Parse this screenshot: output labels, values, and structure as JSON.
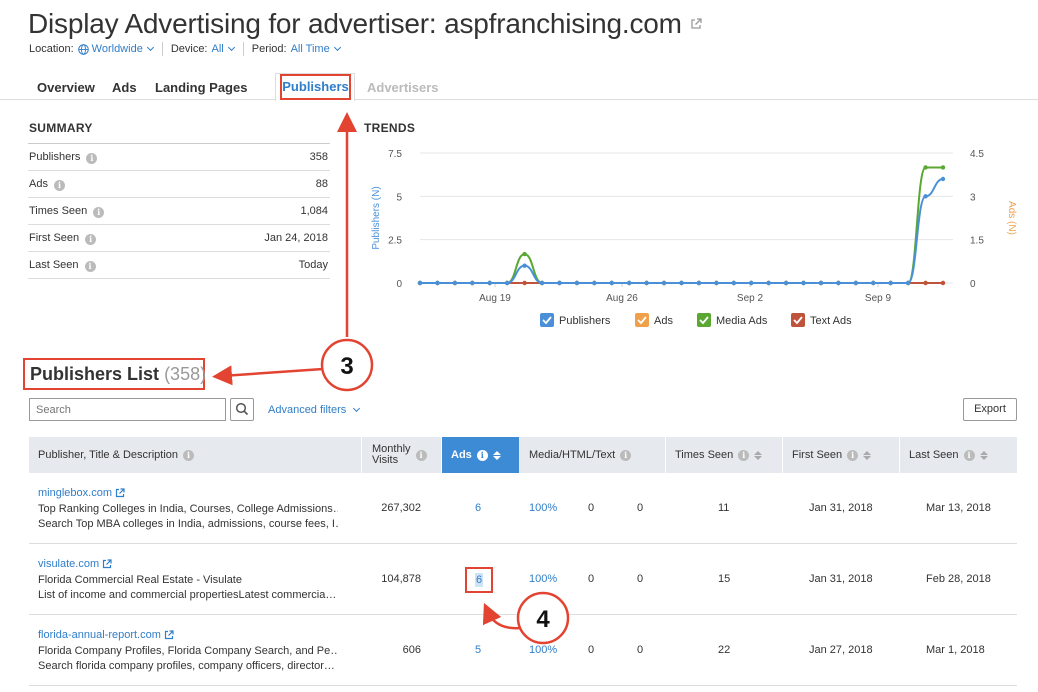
{
  "header": {
    "title_prefix": "Display Advertising for advertiser:",
    "title_domain": "aspfranchising.com",
    "location_label": "Location:",
    "location_value": "Worldwide",
    "device_label": "Device:",
    "device_value": "All",
    "period_label": "Period:",
    "period_value": "All Time"
  },
  "tabs": {
    "overview": "Overview",
    "ads": "Ads",
    "landing_pages": "Landing Pages",
    "publishers": "Publishers",
    "advertisers": "Advertisers"
  },
  "summary": {
    "heading": "SUMMARY",
    "rows": [
      {
        "label": "Publishers",
        "value": "358"
      },
      {
        "label": "Ads",
        "value": "88"
      },
      {
        "label": "Times Seen",
        "value": "1,084"
      },
      {
        "label": "First Seen",
        "value": "Jan 24, 2018"
      },
      {
        "label": "Last Seen",
        "value": "Today"
      }
    ]
  },
  "trends": {
    "heading": "TRENDS"
  },
  "chart_data": {
    "type": "line",
    "title": "TRENDS",
    "xlabel": "",
    "ylabel": "Publishers (N)",
    "y2label": "Ads (N)",
    "ylim": [
      0,
      7.5
    ],
    "y2lim": [
      0,
      4.5
    ],
    "yticks": [
      "0",
      "2.5",
      "5",
      "7.5"
    ],
    "y2ticks": [
      "0",
      "1.5",
      "3",
      "4.5"
    ],
    "xticks": [
      "Aug 19",
      "Aug 26",
      "Sep 2",
      "Sep 9"
    ],
    "x": [
      "Aug 14",
      "Aug 16",
      "Aug 18",
      "Aug 20",
      "Aug 22",
      "Aug 24",
      "Aug 26",
      "Aug 28",
      "Aug 30",
      "Sep 1",
      "Sep 3",
      "Sep 5",
      "Sep 7",
      "Sep 9",
      "Sep 11",
      "Sep 13"
    ],
    "series": [
      {
        "name": "Publishers",
        "color": "#4a90d9",
        "axis": "left",
        "values": [
          0,
          0,
          0,
          0,
          0,
          0,
          1,
          0,
          0,
          0,
          0,
          0,
          0,
          0,
          0,
          0,
          0,
          0,
          0,
          0,
          0,
          0,
          0,
          0,
          0,
          0,
          0,
          0,
          0,
          5,
          6
        ]
      },
      {
        "name": "Ads",
        "color": "#f0a04b",
        "axis": "right",
        "values": [
          0,
          0,
          0,
          0,
          0,
          0,
          0,
          0,
          0,
          0,
          0,
          0,
          0,
          0,
          0,
          0,
          0,
          0,
          0,
          0,
          0,
          0,
          0,
          0,
          0,
          0,
          0,
          0,
          0,
          0,
          0
        ]
      },
      {
        "name": "Media Ads",
        "color": "#5aa832",
        "axis": "right",
        "values": [
          0,
          0,
          0,
          0,
          0,
          0,
          1,
          0,
          0,
          0,
          0,
          0,
          0,
          0,
          0,
          0,
          0,
          0,
          0,
          0,
          0,
          0,
          0,
          0,
          0,
          0,
          0,
          0,
          0,
          4,
          4
        ]
      },
      {
        "name": "Text Ads",
        "color": "#c0533b",
        "axis": "right",
        "values": [
          0,
          0,
          0,
          0,
          0,
          0,
          0,
          0,
          0,
          0,
          0,
          0,
          0,
          0,
          0,
          0,
          0,
          0,
          0,
          0,
          0,
          0,
          0,
          0,
          0,
          0,
          0,
          0,
          0,
          0,
          0
        ]
      }
    ],
    "legend": "bottom",
    "grid": true
  },
  "publishers_list": {
    "title": "Publishers List",
    "count": "(358)",
    "search_placeholder": "Search",
    "advanced_filters": "Advanced filters",
    "export": "Export",
    "columns": {
      "publisher": "Publisher, Title & Description",
      "monthly_visits_1": "Monthly",
      "monthly_visits_2": "Visits",
      "ads": "Ads",
      "media": "Media/HTML/Text",
      "times_seen": "Times Seen",
      "first_seen": "First Seen",
      "last_seen": "Last Seen"
    },
    "rows": [
      {
        "domain": "minglebox.com",
        "title": "Top Ranking Colleges in India, Courses, College Admissions…",
        "desc": "Search Top MBA colleges in India, admissions, course fees, I…",
        "visits": "267,302",
        "ads": "6",
        "media": "100%",
        "html": "0",
        "text": "0",
        "times_seen": "11",
        "first_seen": "Jan 31, 2018",
        "last_seen": "Mar 13, 2018"
      },
      {
        "domain": "visulate.com",
        "title": "Florida Commercial Real Estate - Visulate",
        "desc": "List of income and commercial propertiesLatest commercia…",
        "visits": "104,878",
        "ads": "6",
        "media": "100%",
        "html": "0",
        "text": "0",
        "times_seen": "15",
        "first_seen": "Jan 31, 2018",
        "last_seen": "Feb 28, 2018"
      },
      {
        "domain": "florida-annual-report.com",
        "title": "Florida Company Profiles, Florida Company Search, and Pe…",
        "desc": "Search florida company profiles, company officers, director…",
        "visits": "606",
        "ads": "5",
        "media": "100%",
        "html": "0",
        "text": "0",
        "times_seen": "22",
        "first_seen": "Jan 27, 2018",
        "last_seen": "Mar 1, 2018"
      }
    ]
  },
  "annotations": {
    "step3": "3",
    "step4": "4",
    "color": "#e34431"
  }
}
